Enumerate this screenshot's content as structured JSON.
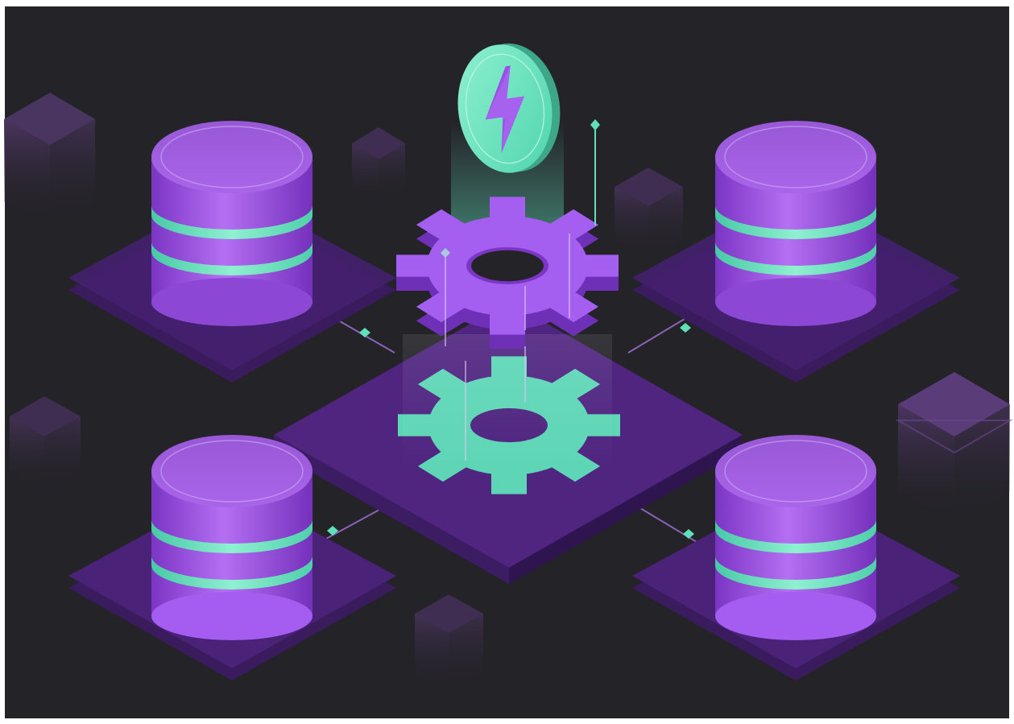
{
  "illustration": {
    "subject": "database-gear-lightning-isometric",
    "elements": {
      "databases": 4,
      "gear": 1,
      "lightning_coin": 1
    }
  },
  "colors": {
    "background": "#242328",
    "frame": "#ffffff",
    "purple_light": "#b36cf3",
    "purple_mid": "#9a52e4",
    "purple_dark": "#6c2fae",
    "platform_top": "#4a2377",
    "platform_side": "#361a58",
    "mint": "#5fe0b9",
    "mint_light": "#8ff0d0",
    "block": "#3b2c49"
  },
  "icons": {
    "gear": "gear-icon",
    "lightning": "lightning-bolt-icon",
    "database": "database-icon"
  }
}
